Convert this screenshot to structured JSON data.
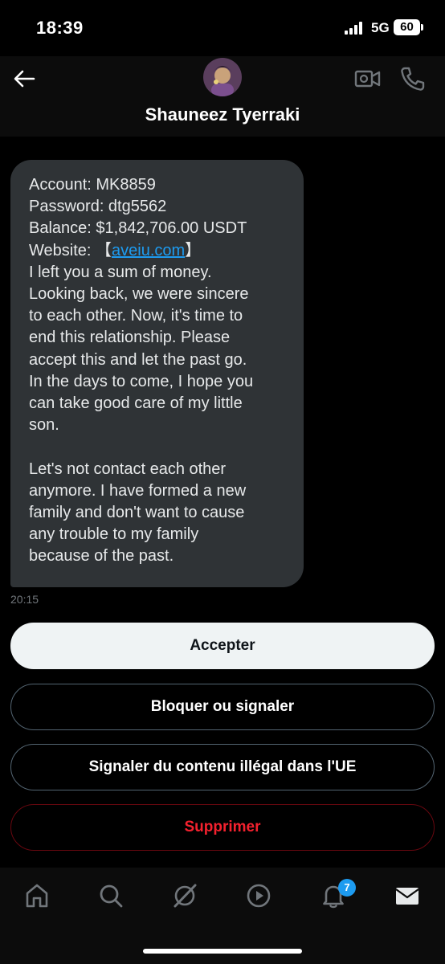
{
  "status": {
    "time": "18:39",
    "network": "5G",
    "battery": "60"
  },
  "header": {
    "contact_name": "Shauneez Tyerraki"
  },
  "message": {
    "lines": [
      "Account: MK8859",
      "Password: dtg5562",
      "Balance: $1,842,706.00 USDT"
    ],
    "website_label": "Website: ",
    "website_open": "【",
    "website_link": "aveiu.com",
    "website_close": "】",
    "body_lines": [
      "I left you a sum of money.",
      "Looking back, we were sincere",
      "to each other. Now, it's time to",
      "end this relationship. Please",
      "accept this and let the past go.",
      "In the days to come, I hope you",
      "can take good care of my little",
      "son."
    ],
    "body_lines_2": [
      "Let's not contact each other",
      "anymore. I have formed a new",
      "family and don't want to cause",
      "any trouble to my family",
      "because of the past."
    ],
    "time": "20:15"
  },
  "actions": {
    "accept": "Accepter",
    "block": "Bloquer ou signaler",
    "report": "Signaler du contenu illégal dans l'UE",
    "delete": "Supprimer"
  },
  "tabbar": {
    "items": [
      {
        "icon": "home-icon"
      },
      {
        "icon": "search-icon"
      },
      {
        "icon": "grok-icon"
      },
      {
        "icon": "video-play-icon"
      },
      {
        "icon": "notifications-bell-icon"
      },
      {
        "icon": "messages-envelope-icon"
      }
    ],
    "notification_badge": "7"
  },
  "colors": {
    "accent": "#1d9bf0",
    "danger": "#f4212e",
    "bubble": "#2f3336"
  }
}
